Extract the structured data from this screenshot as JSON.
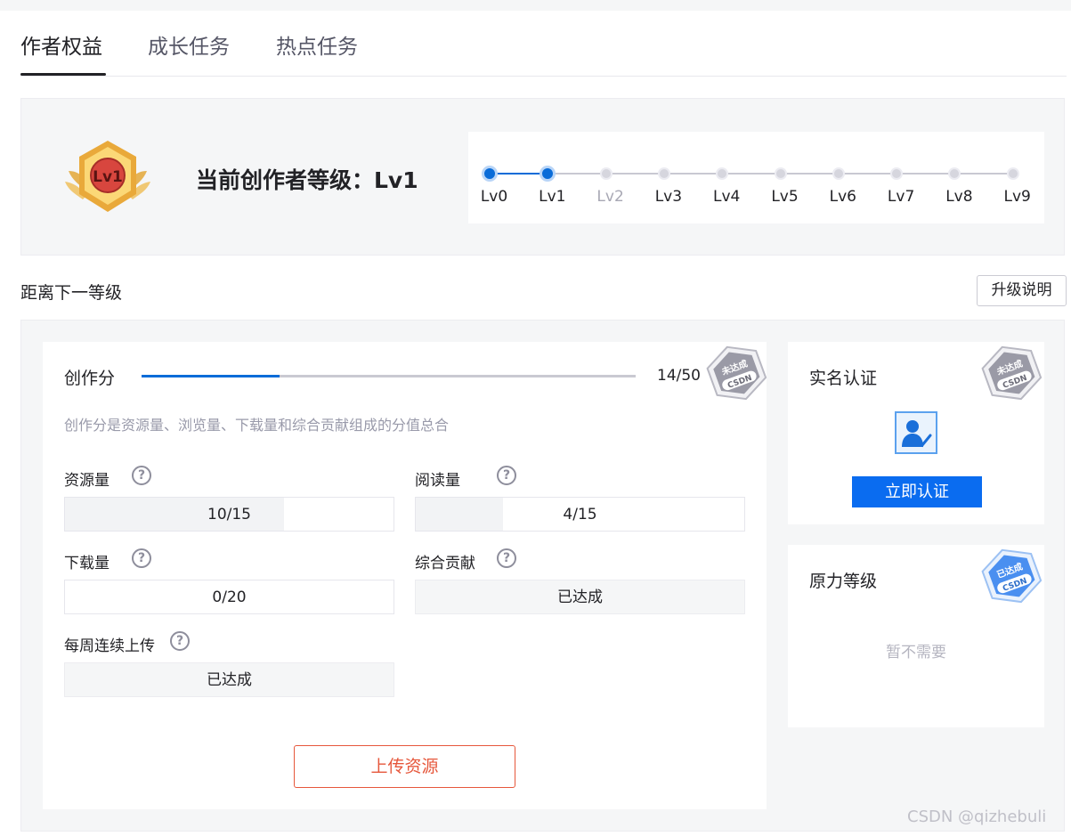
{
  "tabs": [
    {
      "label": "作者权益",
      "active": true
    },
    {
      "label": "成长任务",
      "active": false
    },
    {
      "label": "热点任务",
      "active": false
    }
  ],
  "level": {
    "badge_text": "Lv1",
    "title": "当前创作者等级：Lv1",
    "current_index": 1,
    "levels": [
      "Lv0",
      "Lv1",
      "Lv2",
      "Lv3",
      "Lv4",
      "Lv5",
      "Lv6",
      "Lv7",
      "Lv8",
      "Lv9"
    ],
    "muted_index": 2
  },
  "next_level": {
    "title": "距离下一等级",
    "upgrade_button": "升级说明"
  },
  "creation_score": {
    "label": "创作分",
    "value": 14,
    "max": 50,
    "text": "14/50",
    "description": "创作分是资源量、浏览量、下载量和综合贡献组成的分值总合",
    "stamp_text": "未达成",
    "stamp_brand": "CSDN"
  },
  "metrics": [
    {
      "label": "资源量",
      "value_text": "10/15",
      "progress": 0.6667,
      "done": false
    },
    {
      "label": "阅读量",
      "value_text": "4/15",
      "progress": 0.2667,
      "done": false
    },
    {
      "label": "下载量",
      "value_text": "0/20",
      "progress": 0,
      "done": false
    },
    {
      "label": "综合贡献",
      "value_text": "已达成",
      "progress": 1,
      "done": true
    },
    {
      "label": "每周连续上传",
      "value_text": "已达成",
      "progress": 1,
      "done": true
    }
  ],
  "help_icon": "?",
  "upload_button": "上传资源",
  "real_name": {
    "title": "实名认证",
    "button": "立即认证",
    "stamp_text": "未达成",
    "stamp_brand": "CSDN"
  },
  "force_level": {
    "title": "原力等级",
    "empty_text": "暂不需要",
    "stamp_text": "已达成",
    "stamp_brand": "CSDN"
  },
  "watermark": "CSDN @qizhebuli",
  "colors": {
    "accent_blue": "#0a6cd8",
    "button_blue": "#0a6cf0",
    "upload_red": "#e6573b",
    "stamp_grey": "#8a8a96",
    "stamp_blue": "#4a8ff0"
  }
}
